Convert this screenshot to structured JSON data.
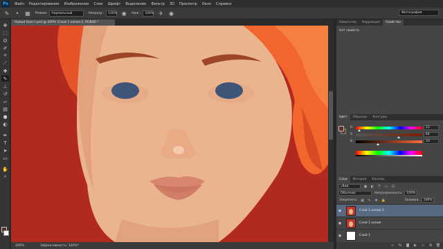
{
  "app": {
    "logo": "Ps"
  },
  "menu": [
    "Файл",
    "Редактирование",
    "Изображение",
    "Слои",
    "Шрифт",
    "Выделение",
    "Фильтр",
    "3D",
    "Просмотр",
    "Окно",
    "Справка"
  ],
  "options": {
    "mode_label": "Режим:",
    "mode_value": "Нормальный",
    "opacity_label": "Непрозр.:",
    "opacity_value": "100%",
    "flow_label": "Наж.:",
    "flow_value": "100%",
    "workspace": "Фотография"
  },
  "document": {
    "tab_title": "Новый Холст.psd @ 200% (Слой 1 копия 2, RGB/8) *",
    "zoom": "200%",
    "status": "Эффективность: 100%*"
  },
  "canvas": {
    "background_color": "#b22a1f",
    "skin_color": "#eab48f",
    "hair_color": "#f2652c",
    "eye_color": "#3e5577",
    "lip_color": "#d8866f",
    "brow_color": "#9c4527"
  },
  "properties": {
    "tabs": [
      "Навигатор",
      "Коррекция",
      "Свойства"
    ],
    "active_tab": 2,
    "empty_text": "Нет свойств"
  },
  "color": {
    "tabs": [
      "Цвет",
      "Образцы",
      "Контуры"
    ],
    "active_tab": 0,
    "foreground": "#5e2f23",
    "channels": [
      {
        "label": "H",
        "value": "12"
      },
      {
        "label": "S",
        "value": "64"
      },
      {
        "label": "B",
        "value": "33"
      }
    ]
  },
  "layers": {
    "tabs": [
      "Слои",
      "История",
      "Каналы"
    ],
    "active_tab": 0,
    "filter_label": "Вид",
    "blend_mode": "Обычные",
    "opacity_label": "Непрозрачность:",
    "opacity_value": "100%",
    "lock_label": "Закрепить:",
    "fill_label": "Заливка:",
    "fill_value": "100%",
    "items": [
      {
        "name": "Слой 1 копия 2",
        "selected": true,
        "thumb": "#c0392b"
      },
      {
        "name": "Слой 1 копия",
        "selected": false,
        "thumb": "#c0392b"
      },
      {
        "name": "Слой 1",
        "selected": false,
        "thumb": "#ffffff"
      }
    ]
  },
  "tools": [
    "move",
    "marquee",
    "lasso",
    "quick-select",
    "crop",
    "eyedropper",
    "healing",
    "brush",
    "clone-stamp",
    "history-brush",
    "eraser",
    "gradient",
    "blur",
    "dodge",
    "pen",
    "type",
    "path-select",
    "shape",
    "hand",
    "zoom"
  ]
}
